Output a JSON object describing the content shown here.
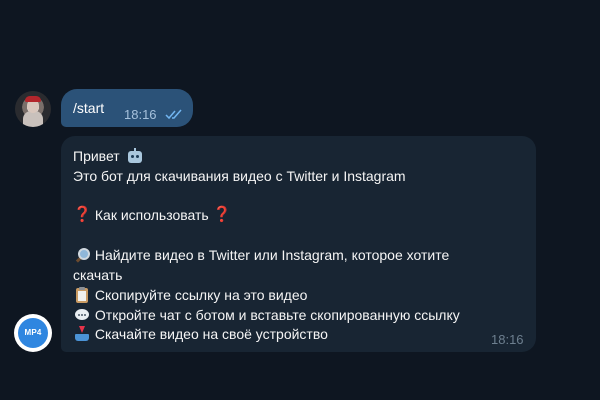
{
  "outgoing": {
    "text": "/start",
    "time": "18:16",
    "status_icon": "double-check-icon"
  },
  "incoming": {
    "greeting": "Привет",
    "greeting_icon": "robot-face-icon",
    "line_intro": "Это бот для скачивания видео с Twitter и Instagram",
    "howto_mark": "❓",
    "howto_title": "Как использовать",
    "step1_icon": "magnifier-icon",
    "step1_a": "Найдите видео в Twitter или Instagram, которое хотите",
    "step1_b": "скачать",
    "step2_icon": "clipboard-icon",
    "step2": "Скопируйте ссылку на это видео",
    "step3_icon": "speech-balloon-icon",
    "step3": "Откройте чат с ботом и вставьте скопированную ссылку",
    "step4_icon": "inbox-tray-icon",
    "step4": "Скачайте видео на своё устройство",
    "time": "18:16"
  },
  "bot_avatar": {
    "label": "MP4"
  },
  "colors": {
    "background": "#0e1621",
    "outgoing_bubble": "#2b5278",
    "incoming_bubble": "#182533",
    "accent_red": "#e8334a"
  }
}
